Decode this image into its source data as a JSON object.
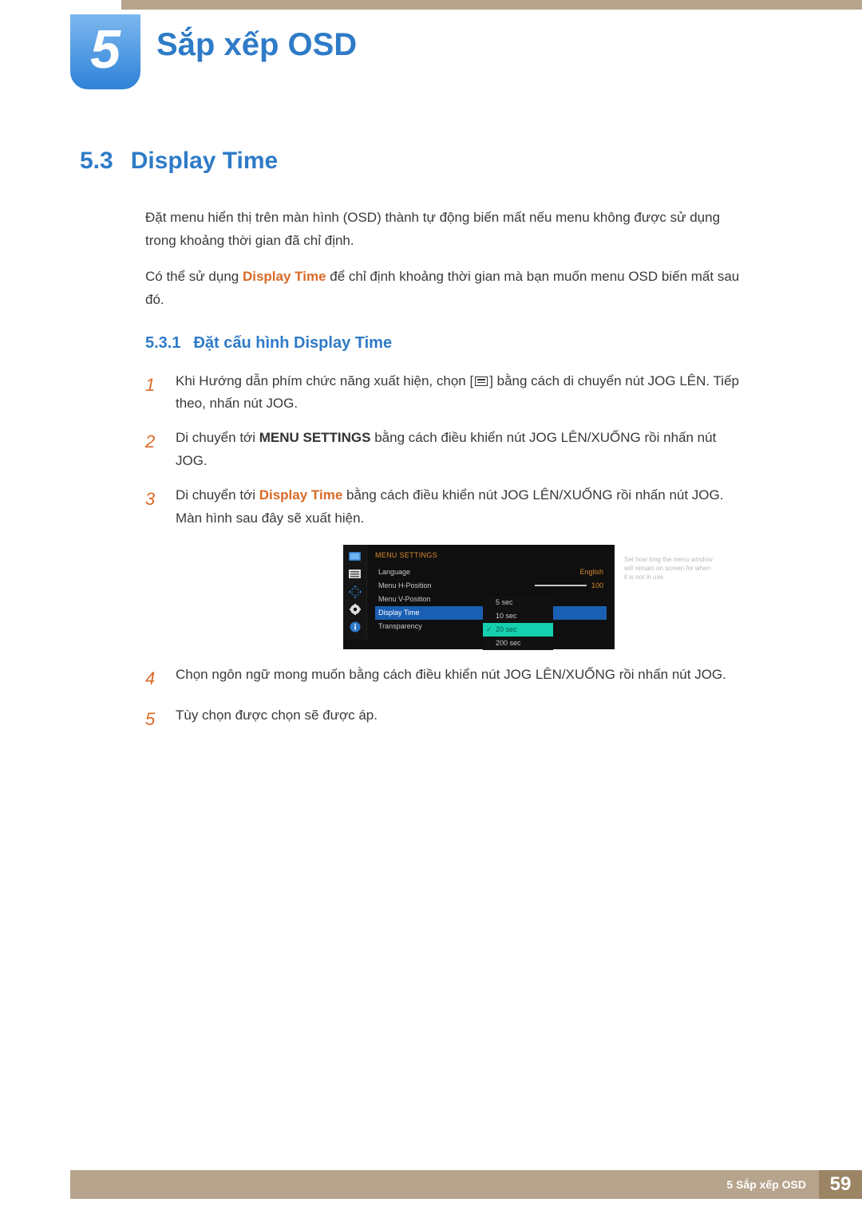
{
  "chapter": {
    "number": "5",
    "title": "Sắp xếp OSD"
  },
  "section": {
    "number": "5.3",
    "title": "Display Time"
  },
  "intro": {
    "p1": "Đặt menu hiển thị trên màn hình (OSD) thành tự động biến mất nếu menu không được sử dụng trong khoảng thời gian đã chỉ định.",
    "p2a": "Có thể sử dụng ",
    "p2_kw": "Display Time",
    "p2b": " để chỉ định khoảng thời gian mà bạn muốn menu OSD biến mất sau đó."
  },
  "subsection": {
    "number": "5.3.1",
    "title": "Đặt cấu hình Display Time"
  },
  "steps": {
    "s1": {
      "n": "1",
      "a": "Khi Hướng dẫn phím chức năng xuất hiện, chọn [",
      "b": "] bằng cách di chuyển nút JOG LÊN. Tiếp theo, nhấn nút JOG."
    },
    "s2": {
      "n": "2",
      "a": "Di chuyển tới ",
      "kw": "MENU SETTINGS",
      "b": " bằng cách điều khiển nút JOG LÊN/XUỐNG rồi nhấn nút JOG."
    },
    "s3": {
      "n": "3",
      "a": "Di chuyển tới ",
      "kw": "Display Time",
      "b": " bằng cách điều khiển nút JOG LÊN/XUỐNG rồi nhấn nút JOG. Màn hình sau đây sẽ xuất hiện."
    },
    "s4": {
      "n": "4",
      "t": "Chọn ngôn ngữ mong muốn bằng cách điều khiển nút JOG LÊN/XUỐNG rồi nhấn nút JOG."
    },
    "s5": {
      "n": "5",
      "t": "Tùy chọn được chọn sẽ được áp."
    }
  },
  "osd": {
    "title": "MENU SETTINGS",
    "help": "Set how long the menu window will remain on screen for when it is not in use.",
    "rows": {
      "language": {
        "label": "Language",
        "value": "English"
      },
      "hpos": {
        "label": "Menu H-Position",
        "value": "100"
      },
      "vpos": {
        "label": "Menu V-Position"
      },
      "dtime": {
        "label": "Display Time"
      },
      "transp": {
        "label": "Transparency"
      }
    },
    "options": {
      "o1": "5 sec",
      "o2": "10 sec",
      "o3": "20 sec",
      "o4": "200 sec"
    }
  },
  "footer": {
    "label": "5 Sắp xếp OSD",
    "page": "59"
  }
}
